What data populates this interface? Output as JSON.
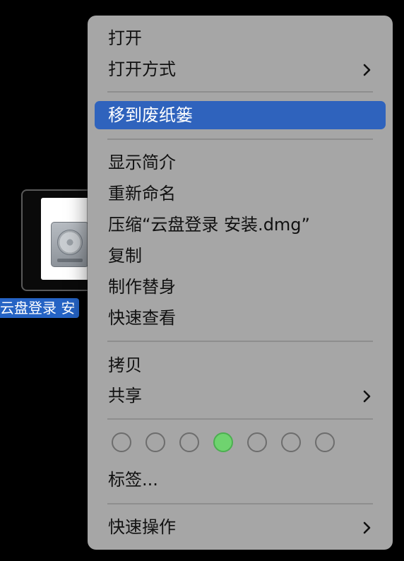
{
  "desktop": {
    "file": {
      "icon": "disk-image-icon",
      "name_visible": "云盘登录 安"
    }
  },
  "context_menu": {
    "open": "打开",
    "open_with": "打开方式",
    "move_to_trash": "移到废纸篓",
    "get_info": "显示简介",
    "rename": "重新命名",
    "compress": "压缩“云盘登录 安装.dmg”",
    "duplicate": "复制",
    "make_alias": "制作替身",
    "quick_look": "快速查看",
    "copy": "拷贝",
    "share": "共享",
    "tags": "标签...",
    "quick_actions": "快速操作",
    "tag_colors": [
      {
        "name": "none",
        "color": "transparent",
        "selected": false
      },
      {
        "name": "none",
        "color": "transparent",
        "selected": false
      },
      {
        "name": "none",
        "color": "transparent",
        "selected": false
      },
      {
        "name": "green",
        "color": "#6fd36f",
        "selected": true
      },
      {
        "name": "none",
        "color": "transparent",
        "selected": false
      },
      {
        "name": "none",
        "color": "transparent",
        "selected": false
      },
      {
        "name": "none",
        "color": "transparent",
        "selected": false
      }
    ],
    "highlight_color": "#2f63bd",
    "submenu_icon": "chevron-right-icon"
  }
}
